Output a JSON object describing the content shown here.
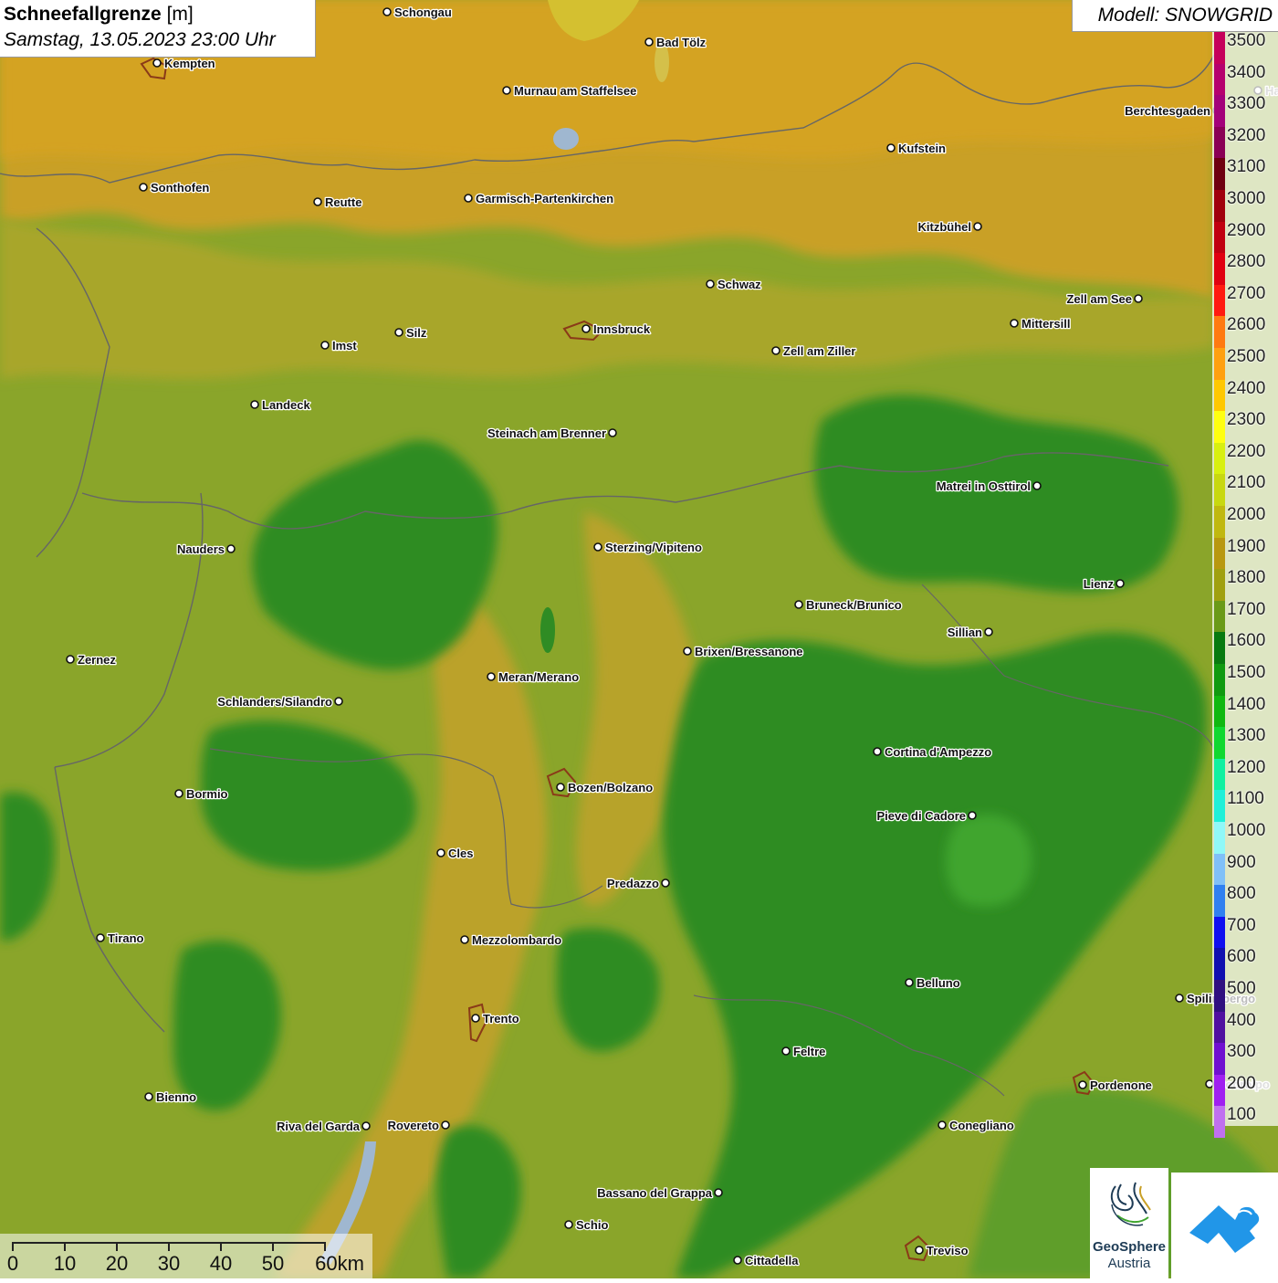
{
  "title": {
    "main_bold": "Schneefallgrenze",
    "unit": "[m]",
    "datetime": "Samstag, 13.05.2023 23:00 Uhr"
  },
  "model": {
    "label": "Modell: SNOWGRID"
  },
  "legend": {
    "entries": [
      {
        "label": "3500",
        "color": "#c5005b"
      },
      {
        "label": "3400",
        "color": "#b5006e"
      },
      {
        "label": "3300",
        "color": "#a3007a"
      },
      {
        "label": "3200",
        "color": "#8a0055"
      },
      {
        "label": "3100",
        "color": "#6e0010"
      },
      {
        "label": "3000",
        "color": "#a0000c"
      },
      {
        "label": "2900",
        "color": "#c00010"
      },
      {
        "label": "2800",
        "color": "#e00010"
      },
      {
        "label": "2700",
        "color": "#ff1a10"
      },
      {
        "label": "2600",
        "color": "#ff7a10"
      },
      {
        "label": "2500",
        "color": "#ffa010"
      },
      {
        "label": "2400",
        "color": "#ffc800"
      },
      {
        "label": "2300",
        "color": "#ffff10"
      },
      {
        "label": "2200",
        "color": "#d8f010"
      },
      {
        "label": "2100",
        "color": "#c8d810"
      },
      {
        "label": "2000",
        "color": "#c0b810"
      },
      {
        "label": "1900",
        "color": "#b89810"
      },
      {
        "label": "1800",
        "color": "#a0a010"
      },
      {
        "label": "1700",
        "color": "#6a9a18"
      },
      {
        "label": "1600",
        "color": "#087a10"
      },
      {
        "label": "1500",
        "color": "#109a10"
      },
      {
        "label": "1400",
        "color": "#10b810"
      },
      {
        "label": "1300",
        "color": "#10d830"
      },
      {
        "label": "1200",
        "color": "#10f0a0"
      },
      {
        "label": "1100",
        "color": "#20f0d8"
      },
      {
        "label": "1000",
        "color": "#90f8f8"
      },
      {
        "label": "900",
        "color": "#80c0f8"
      },
      {
        "label": "800",
        "color": "#3080f0"
      },
      {
        "label": "700",
        "color": "#1010f0"
      },
      {
        "label": "600",
        "color": "#1010b0"
      },
      {
        "label": "500",
        "color": "#301080"
      },
      {
        "label": "400",
        "color": "#5010a0"
      },
      {
        "label": "300",
        "color": "#7010d0"
      },
      {
        "label": "200",
        "color": "#a020f0"
      },
      {
        "label": "100",
        "color": "#c070f0"
      }
    ]
  },
  "cities": [
    {
      "name": "Schongau",
      "side": "right"
    },
    {
      "name": "Bad Tölz",
      "side": "right"
    },
    {
      "name": "Kempten",
      "side": "right"
    },
    {
      "name": "Murnau am Staffelsee",
      "side": "right"
    },
    {
      "name": "Berchtesgaden",
      "side": "left"
    },
    {
      "name": "Kufstein",
      "side": "right"
    },
    {
      "name": "Sonthofen",
      "side": "right"
    },
    {
      "name": "Reutte",
      "side": "right"
    },
    {
      "name": "Garmisch-Partenkirchen",
      "side": "right"
    },
    {
      "name": "Kitzbühel",
      "side": "left"
    },
    {
      "name": "Schwaz",
      "side": "right"
    },
    {
      "name": "Zell am See",
      "side": "left"
    },
    {
      "name": "Innsbruck",
      "side": "right"
    },
    {
      "name": "Mittersill",
      "side": "right"
    },
    {
      "name": "Imst",
      "side": "right"
    },
    {
      "name": "Silz",
      "side": "right"
    },
    {
      "name": "Zell am Ziller",
      "side": "right"
    },
    {
      "name": "Landeck",
      "side": "right"
    },
    {
      "name": "Steinach am Brenner",
      "side": "left"
    },
    {
      "name": "Matrei in Osttirol",
      "side": "left"
    },
    {
      "name": "Nauders",
      "side": "left"
    },
    {
      "name": "Sterzing/Vipiteno",
      "side": "right"
    },
    {
      "name": "Lienz",
      "side": "left"
    },
    {
      "name": "Bruneck/Brunico",
      "side": "right"
    },
    {
      "name": "Sillian",
      "side": "left"
    },
    {
      "name": "Brixen/Bressanone",
      "side": "right"
    },
    {
      "name": "Zernez",
      "side": "right"
    },
    {
      "name": "Meran/Merano",
      "side": "right"
    },
    {
      "name": "Schlanders/Silandro",
      "side": "left"
    },
    {
      "name": "Cortina d'Ampezzo",
      "side": "right"
    },
    {
      "name": "Bozen/Bolzano",
      "side": "right"
    },
    {
      "name": "Bormio",
      "side": "right"
    },
    {
      "name": "Pieve di Cadore",
      "side": "left"
    },
    {
      "name": "Cles",
      "side": "right"
    },
    {
      "name": "Predazzo",
      "side": "left"
    },
    {
      "name": "Tirano",
      "side": "right"
    },
    {
      "name": "Mezzolombardo",
      "side": "right"
    },
    {
      "name": "Belluno",
      "side": "right"
    },
    {
      "name": "Spilimbergo",
      "side": "right"
    },
    {
      "name": "Trento",
      "side": "right"
    },
    {
      "name": "Feltre",
      "side": "right"
    },
    {
      "name": "Pordenone",
      "side": "right"
    },
    {
      "name": "Bienno",
      "side": "right"
    },
    {
      "name": "Riva del Garda",
      "side": "left"
    },
    {
      "name": "Rovereto",
      "side": "left"
    },
    {
      "name": "Conegliano",
      "side": "right"
    },
    {
      "name": "Bassano del Grappa",
      "side": "left"
    },
    {
      "name": "Schio",
      "side": "right"
    },
    {
      "name": "Treviso",
      "side": "right"
    },
    {
      "name": "Cittadella",
      "side": "right"
    },
    {
      "name": "Hallein",
      "side": "right"
    },
    {
      "name": "Codroipo",
      "side": "right"
    }
  ],
  "scalebar": {
    "ticks": [
      "0",
      "10",
      "20",
      "30",
      "40",
      "50",
      "60km"
    ]
  },
  "logos": {
    "geosphere_line1": "GeoSphere",
    "geosphere_line2": "Austria"
  }
}
